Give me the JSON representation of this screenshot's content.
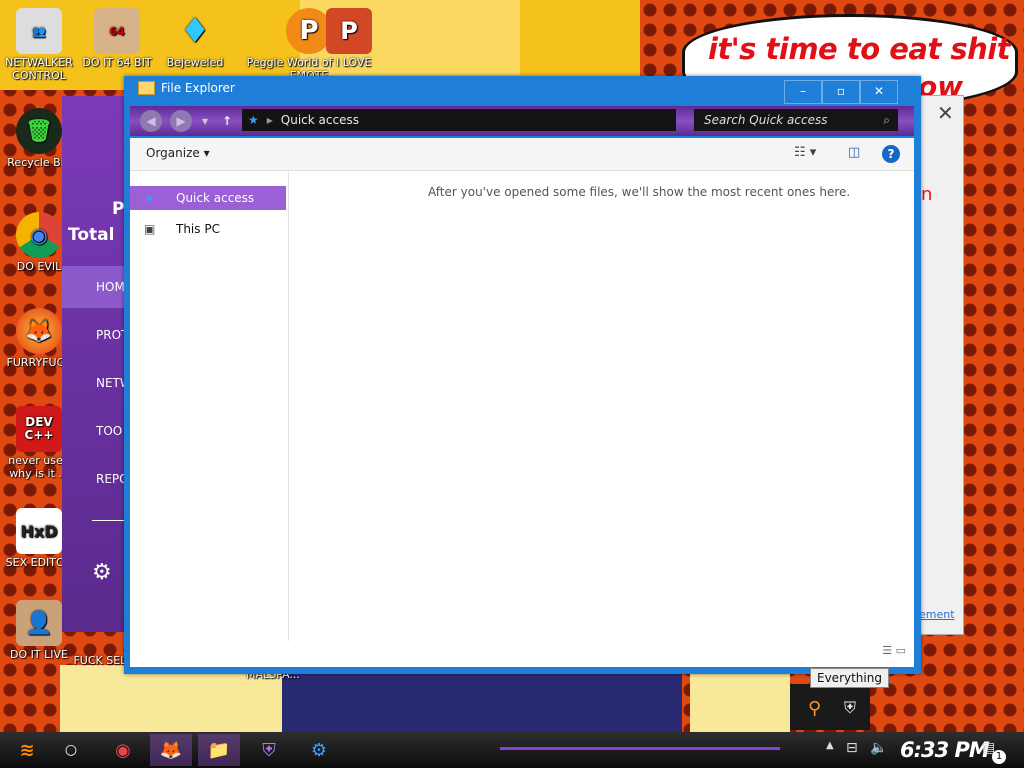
{
  "desktop": {
    "bubble_text": "it's time to eat shit",
    "bubble_text2": "ow",
    "icons": [
      {
        "label": "NETWALKER CONTROL",
        "glyph": "👥"
      },
      {
        "label": "DO IT 64 BIT",
        "glyph": "64"
      },
      {
        "label": "Bejeweled",
        "glyph": "♦"
      },
      {
        "label": "Peggle World of I LOVE EMOTE",
        "glyph": "P"
      },
      {
        "label": "",
        "glyph": "P"
      },
      {
        "label": "Recycle Bin",
        "glyph": "🗑"
      },
      {
        "label": "DO EVIL",
        "glyph": "◉"
      },
      {
        "label": "FURRYFUCK",
        "glyph": "🦊"
      },
      {
        "label": "never used why is it ...",
        "glyph": "DEV C++"
      },
      {
        "label": "SEX EDITOR",
        "glyph": "HxD"
      },
      {
        "label": "DO IT LIVE",
        "glyph": "👤"
      },
      {
        "label": "FUCK SELVES",
        "glyph": ""
      },
      {
        "label": "MALSPA...",
        "glyph": ""
      }
    ]
  },
  "antivirus": {
    "title_line1": "P",
    "title_line2": "Total",
    "nav": [
      "HOM",
      "PROT",
      "NETW",
      "TOO",
      "REPO"
    ]
  },
  "behind_window": {
    "close": "✕",
    "red_text": "n",
    "link_text": "ement"
  },
  "file_explorer": {
    "title": "File Explorer",
    "minimize": "–",
    "maximize": "▫",
    "close": "✕",
    "back": "◀",
    "forward": "▶",
    "up": "↑",
    "address": "Quick access",
    "search_placeholder": "Search Quick access",
    "organize": "Organize",
    "nav_items": [
      {
        "label": "Quick access",
        "icon": "★"
      },
      {
        "label": "This PC",
        "icon": "▣"
      }
    ],
    "empty_message": "After you've opened some files, we'll show the most recent ones here."
  },
  "tooltip": "Everything",
  "taskbar": {
    "clock": "6:33 PM",
    "notification_count": "1",
    "items": [
      {
        "name": "chrome",
        "glyph": "◉"
      },
      {
        "name": "firefox",
        "glyph": "🦊"
      },
      {
        "name": "file-explorer",
        "glyph": "📁"
      },
      {
        "name": "shield-app",
        "glyph": "⛨"
      },
      {
        "name": "app",
        "glyph": "⚙"
      }
    ]
  }
}
